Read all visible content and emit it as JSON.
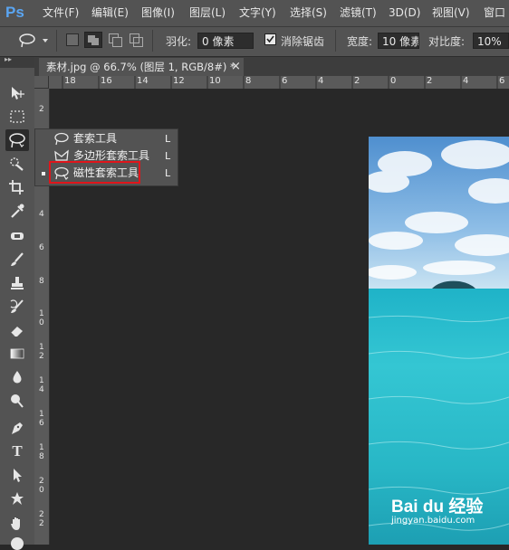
{
  "app": {
    "logo": "Ps"
  },
  "menu": [
    "文件(F)",
    "编辑(E)",
    "图像(I)",
    "图层(L)",
    "文字(Y)",
    "选择(S)",
    "滤镜(T)",
    "3D(D)",
    "视图(V)",
    "窗口"
  ],
  "options": {
    "feather_label": "羽化:",
    "feather_value": "0 像素",
    "antialias_label": "消除锯齿",
    "antialias_checked": true,
    "width_label": "宽度:",
    "width_value": "10 像素",
    "contrast_label": "对比度:",
    "contrast_value": "10%"
  },
  "document_tab": {
    "title": "素材.jpg @ 66.7% (图层 1, RGB/8#) *",
    "close": "×"
  },
  "rulers": {
    "horizontal": [
      "18",
      "16",
      "14",
      "12",
      "10",
      "8",
      "6",
      "4",
      "2",
      "0",
      "2",
      "4",
      "6"
    ],
    "vertical": [
      "2",
      "4",
      "6",
      "8",
      "1\n0",
      "1\n2",
      "1\n4",
      "1\n6",
      "1\n8",
      "2\n0",
      "2\n2"
    ]
  },
  "lasso_flyout": [
    {
      "label": "套索工具",
      "shortcut": "L",
      "icon": "lasso-icon",
      "active": false
    },
    {
      "label": "多边形套索工具",
      "shortcut": "L",
      "icon": "polygonal-lasso-icon",
      "active": false
    },
    {
      "label": "磁性套索工具",
      "shortcut": "L",
      "icon": "magnetic-lasso-icon",
      "active": true
    }
  ],
  "tools": [
    "move-icon",
    "marquee-icon",
    "lasso-icon",
    "quick-selection-icon",
    "crop-icon",
    "eyedropper-icon",
    "healing-brush-icon",
    "brush-icon",
    "clone-stamp-icon",
    "history-brush-icon",
    "eraser-icon",
    "gradient-icon",
    "blur-icon",
    "dodge-icon",
    "pen-icon",
    "type-icon",
    "path-selection-icon",
    "shape-icon",
    "hand-icon"
  ],
  "watermark": {
    "brand": "Bai du 经验",
    "url": "jingyan.baidu.com"
  },
  "colors": {
    "highlight": "#e0151b",
    "panel": "#535353",
    "canvas": "#282828",
    "logo": "#5aa5f2"
  }
}
